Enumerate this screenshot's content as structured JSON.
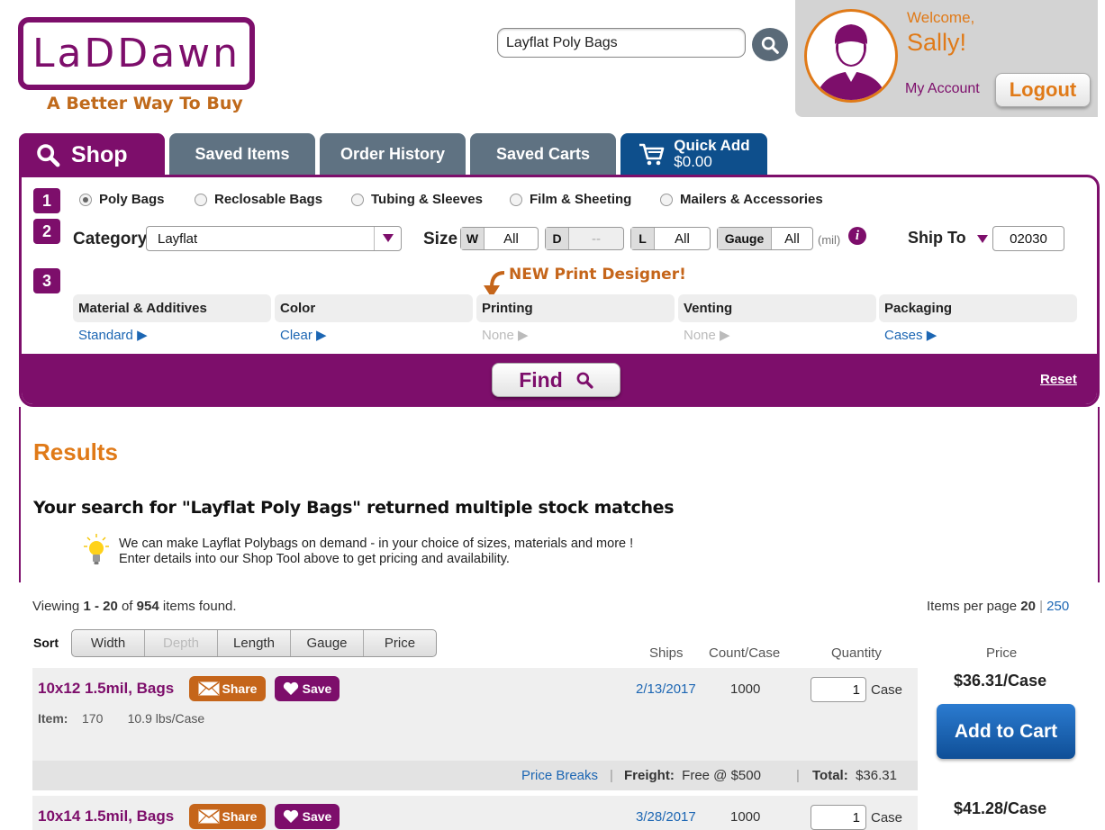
{
  "brand": {
    "logo": "LaDDawn",
    "tagline": "A Better Way To Buy"
  },
  "search": {
    "value": "Layflat Poly Bags"
  },
  "user": {
    "welcome": "Welcome,",
    "name": "Sally!",
    "my_account": "My Account",
    "logout": "Logout"
  },
  "tabs": [
    {
      "label": "Shop"
    },
    {
      "label": "Saved Items"
    },
    {
      "label": "Order History"
    },
    {
      "label": "Saved Carts"
    }
  ],
  "quick_add": {
    "label": "Quick Add",
    "amount": "$0.00"
  },
  "steps": [
    "1",
    "2",
    "3"
  ],
  "categories": [
    {
      "label": "Poly Bags",
      "selected": true
    },
    {
      "label": "Reclosable Bags"
    },
    {
      "label": "Tubing & Sleeves"
    },
    {
      "label": "Film & Sheeting"
    },
    {
      "label": "Mailers & Accessories"
    }
  ],
  "filters": {
    "category_label": "Category",
    "category_value": "Layflat",
    "size_label": "Size",
    "w_key": "W",
    "w_val": "All",
    "d_key": "D",
    "d_val": "--",
    "l_key": "L",
    "l_val": "All",
    "gauge_key": "Gauge",
    "gauge_val": "All",
    "gauge_unit": "(mil)",
    "shipto_label": "Ship To",
    "shipto_val": "02030"
  },
  "print_designer": "NEW Print Designer!",
  "options": [
    {
      "header": "Material & Additives",
      "value": "Standard",
      "enabled": true
    },
    {
      "header": "Color",
      "value": "Clear",
      "enabled": true
    },
    {
      "header": "Printing",
      "value": "None",
      "enabled": false
    },
    {
      "header": "Venting",
      "value": "None",
      "enabled": false
    },
    {
      "header": "Packaging",
      "value": "Cases",
      "enabled": true
    }
  ],
  "find": "Find",
  "reset": "Reset",
  "results": {
    "heading": "Results",
    "message": "Your search for \"Layflat Poly Bags\" returned multiple stock matches",
    "tip_line1": "We can make Layflat Polybags on demand - in your choice of sizes, materials and more !",
    "tip_line2": "Enter details into our Shop Tool above to get pricing and availability.",
    "viewing_pre": "Viewing ",
    "viewing_range": "1 - 20",
    "viewing_of": " of ",
    "viewing_total": "954",
    "viewing_post": " items found.",
    "ipp_label": "Items per page ",
    "ipp_current": "20",
    "ipp_sep": "|",
    "ipp_other": "250"
  },
  "sort": {
    "label": "Sort",
    "options": [
      "Width",
      "Depth",
      "Length",
      "Gauge",
      "Price"
    ]
  },
  "columns": {
    "ships": "Ships",
    "count": "Count/Case",
    "quantity": "Quantity",
    "price": "Price"
  },
  "products": [
    {
      "name": "10x12 1.5mil, Bags",
      "share": "Share",
      "save": "Save",
      "ships": "2/13/2017",
      "count": "1000",
      "qty": "1",
      "unit": "Case",
      "price": "$36.31/Case",
      "item_label": "Item:",
      "item_no": "170",
      "weight": "10.9 lbs/Case",
      "add": "Add to Cart",
      "price_breaks": "Price Breaks",
      "freight_label": "Freight:",
      "freight_val": "Free @ $500",
      "total_label": "Total:",
      "total_val": "$36.31"
    },
    {
      "name": "10x14 1.5mil, Bags",
      "share": "Share",
      "save": "Save",
      "ships": "3/28/2017",
      "count": "1000",
      "qty": "1",
      "unit": "Case",
      "price": "$41.28/Case"
    }
  ],
  "colors": {
    "brand_purple": "#7d0e6b",
    "accent_orange": "#e07a18",
    "tab_gray": "#5f7282",
    "quick_add_blue": "#0e4f8c",
    "link_blue": "#1c66b3"
  }
}
